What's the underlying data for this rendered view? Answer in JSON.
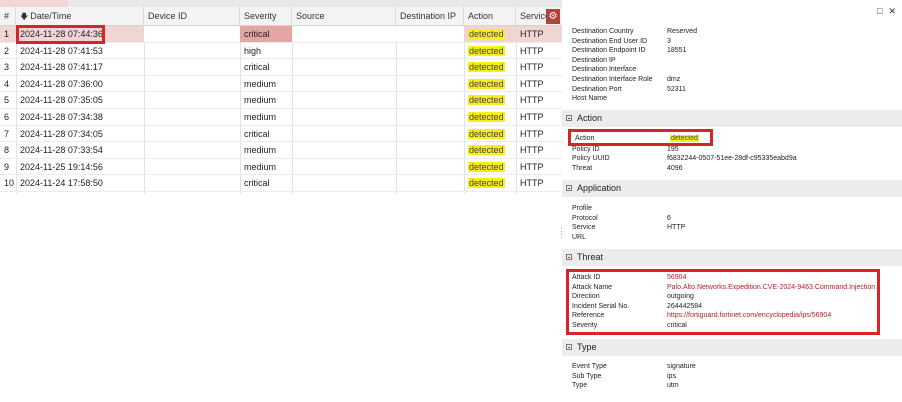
{
  "table": {
    "columns": [
      "#",
      "Date/Time",
      "Device ID",
      "Severity",
      "Source",
      "Destination IP",
      "Action",
      "Service"
    ],
    "rows": [
      {
        "n": "1",
        "datetime": "2024-11-28 07:44:36",
        "severity": "critical",
        "action": "detected",
        "service": "HTTP"
      },
      {
        "n": "2",
        "datetime": "2024-11-28 07:41:53",
        "severity": "high",
        "action": "detected",
        "service": "HTTP"
      },
      {
        "n": "3",
        "datetime": "2024-11-28 07:41:17",
        "severity": "critical",
        "action": "detected",
        "service": "HTTP"
      },
      {
        "n": "4",
        "datetime": "2024-11-28 07:36:00",
        "severity": "medium",
        "action": "detected",
        "service": "HTTP"
      },
      {
        "n": "5",
        "datetime": "2024-11-28 07:35:05",
        "severity": "medium",
        "action": "detected",
        "service": "HTTP"
      },
      {
        "n": "6",
        "datetime": "2024-11-28 07:34:38",
        "severity": "medium",
        "action": "detected",
        "service": "HTTP"
      },
      {
        "n": "7",
        "datetime": "2024-11-28 07:34:05",
        "severity": "critical",
        "action": "detected",
        "service": "HTTP"
      },
      {
        "n": "8",
        "datetime": "2024-11-28 07:33:54",
        "severity": "medium",
        "action": "detected",
        "service": "HTTP"
      },
      {
        "n": "9",
        "datetime": "2024-11-25 19:14:56",
        "severity": "medium",
        "action": "detected",
        "service": "HTTP"
      },
      {
        "n": "10",
        "datetime": "2024-11-24 17:58:50",
        "severity": "critical",
        "action": "detected",
        "service": "HTTP"
      }
    ],
    "selected_row": "1",
    "sort_icon": "arrow-down-icon",
    "settings_icon": "gear-icon"
  },
  "details": {
    "destination": [
      {
        "k": "Destination Country",
        "v": "Reserved"
      },
      {
        "k": "Destination End User ID",
        "v": "3"
      },
      {
        "k": "Destination Endpoint ID",
        "v": "18551"
      },
      {
        "k": "Destination IP",
        "v": ""
      },
      {
        "k": "Destination Interface",
        "v": ""
      },
      {
        "k": "Destination Interface Role",
        "v": "dmz"
      },
      {
        "k": "Destination Port",
        "v": "52311"
      },
      {
        "k": "Host Name",
        "v": ""
      }
    ],
    "action_section": {
      "title": "Action",
      "rows": [
        {
          "k": "Action",
          "v": "detected"
        },
        {
          "k": "Policy ID",
          "v": "195"
        },
        {
          "k": "Policy UUID",
          "v": "f6832244-0507-51ee-28df-c95335eabd9a"
        },
        {
          "k": "Threat",
          "v": "4096"
        }
      ]
    },
    "application_section": {
      "title": "Application",
      "rows": [
        {
          "k": "Profile",
          "v": ""
        },
        {
          "k": "Protocol",
          "v": "6"
        },
        {
          "k": "Service",
          "v": "HTTP"
        },
        {
          "k": "URL",
          "v": ""
        }
      ]
    },
    "threat_section": {
      "title": "Threat",
      "rows": [
        {
          "k": "Attack ID",
          "v": "56904"
        },
        {
          "k": "Attack Name",
          "v": "Palo.Alto.Networks.Expedition.CVE-2024-9463.Command.Injection"
        },
        {
          "k": "Direction",
          "v": "outgoing"
        },
        {
          "k": "Incident Serial No.",
          "v": "264442584"
        },
        {
          "k": "Reference",
          "v": "https://fortiguard.fortinet.com/encyclopedia/ips/56904"
        },
        {
          "k": "Severity",
          "v": "critical"
        }
      ]
    },
    "type_section": {
      "title": "Type",
      "rows": [
        {
          "k": "Event Type",
          "v": "signature"
        },
        {
          "k": "Sub Type",
          "v": "ips"
        },
        {
          "k": "Type",
          "v": "utm"
        }
      ]
    },
    "pane_icons": [
      "restore-window-icon",
      "close-icon"
    ]
  },
  "colors": {
    "highlight_red": "#d9232a",
    "detected_yellow": "#f8ee1d",
    "selected_row": "#f1d4d4",
    "link": "#b0232a"
  }
}
